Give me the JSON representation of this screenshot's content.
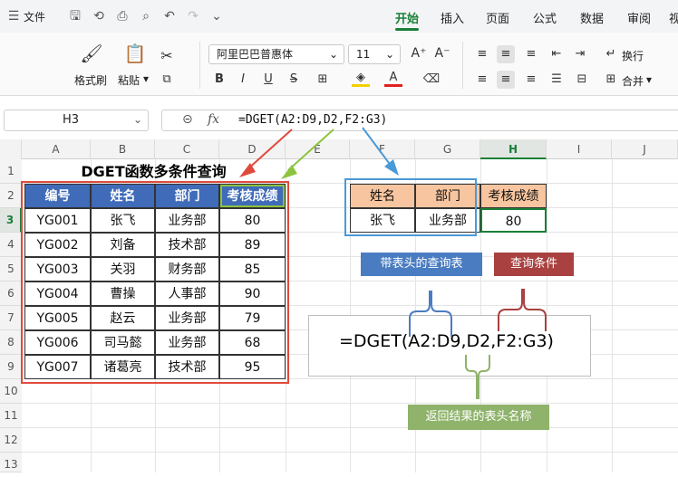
{
  "ribbon": {
    "file_label": "文件",
    "tabs": [
      "开始",
      "插入",
      "页面",
      "公式",
      "数据",
      "审阅",
      "视"
    ],
    "format_painter": "格式刷",
    "paste": "粘贴",
    "font_name": "阿里巴巴普惠体",
    "font_size": "11",
    "wrap": "换行",
    "merge": "合并"
  },
  "formula_bar": {
    "name_box": "H3",
    "fx": "fx",
    "formula": "=DGET(A2:D9,D2,F2:G3)"
  },
  "columns": [
    "A",
    "B",
    "C",
    "D",
    "E",
    "F",
    "G",
    "H",
    "I",
    "J"
  ],
  "rows": [
    "1",
    "2",
    "3",
    "4",
    "5",
    "6",
    "7",
    "8",
    "9",
    "10",
    "11",
    "12",
    "13"
  ],
  "sheet": {
    "title": "DGET函数多条件查询",
    "table_headers": [
      "编号",
      "姓名",
      "部门",
      "考核成绩"
    ],
    "table_rows": [
      [
        "YG001",
        "张飞",
        "业务部",
        "80"
      ],
      [
        "YG002",
        "刘备",
        "技术部",
        "89"
      ],
      [
        "YG003",
        "关羽",
        "财务部",
        "85"
      ],
      [
        "YG004",
        "曹操",
        "人事部",
        "90"
      ],
      [
        "YG005",
        "赵云",
        "业务部",
        "79"
      ],
      [
        "YG006",
        "司马懿",
        "业务部",
        "68"
      ],
      [
        "YG007",
        "诸葛亮",
        "技术部",
        "95"
      ]
    ],
    "criteria_headers": [
      "姓名",
      "部门",
      "考核成绩"
    ],
    "criteria_values": [
      "张飞",
      "业务部",
      "80"
    ]
  },
  "annotations": {
    "db_label": "带表头的查询表",
    "criteria_label": "查询条件",
    "big_formula": "=DGET(A2:D9,D2,F2:G3)",
    "field_label": "返回结果的表头名称"
  },
  "colors": {
    "accent": "#1a7f37",
    "header_blue": "#3f6bb8",
    "criteria_orange": "#f7c59f",
    "label_blue": "#4a7cc1",
    "label_red": "#a8413f",
    "label_green": "#8fb36b",
    "red_border": "#e04a3c"
  }
}
